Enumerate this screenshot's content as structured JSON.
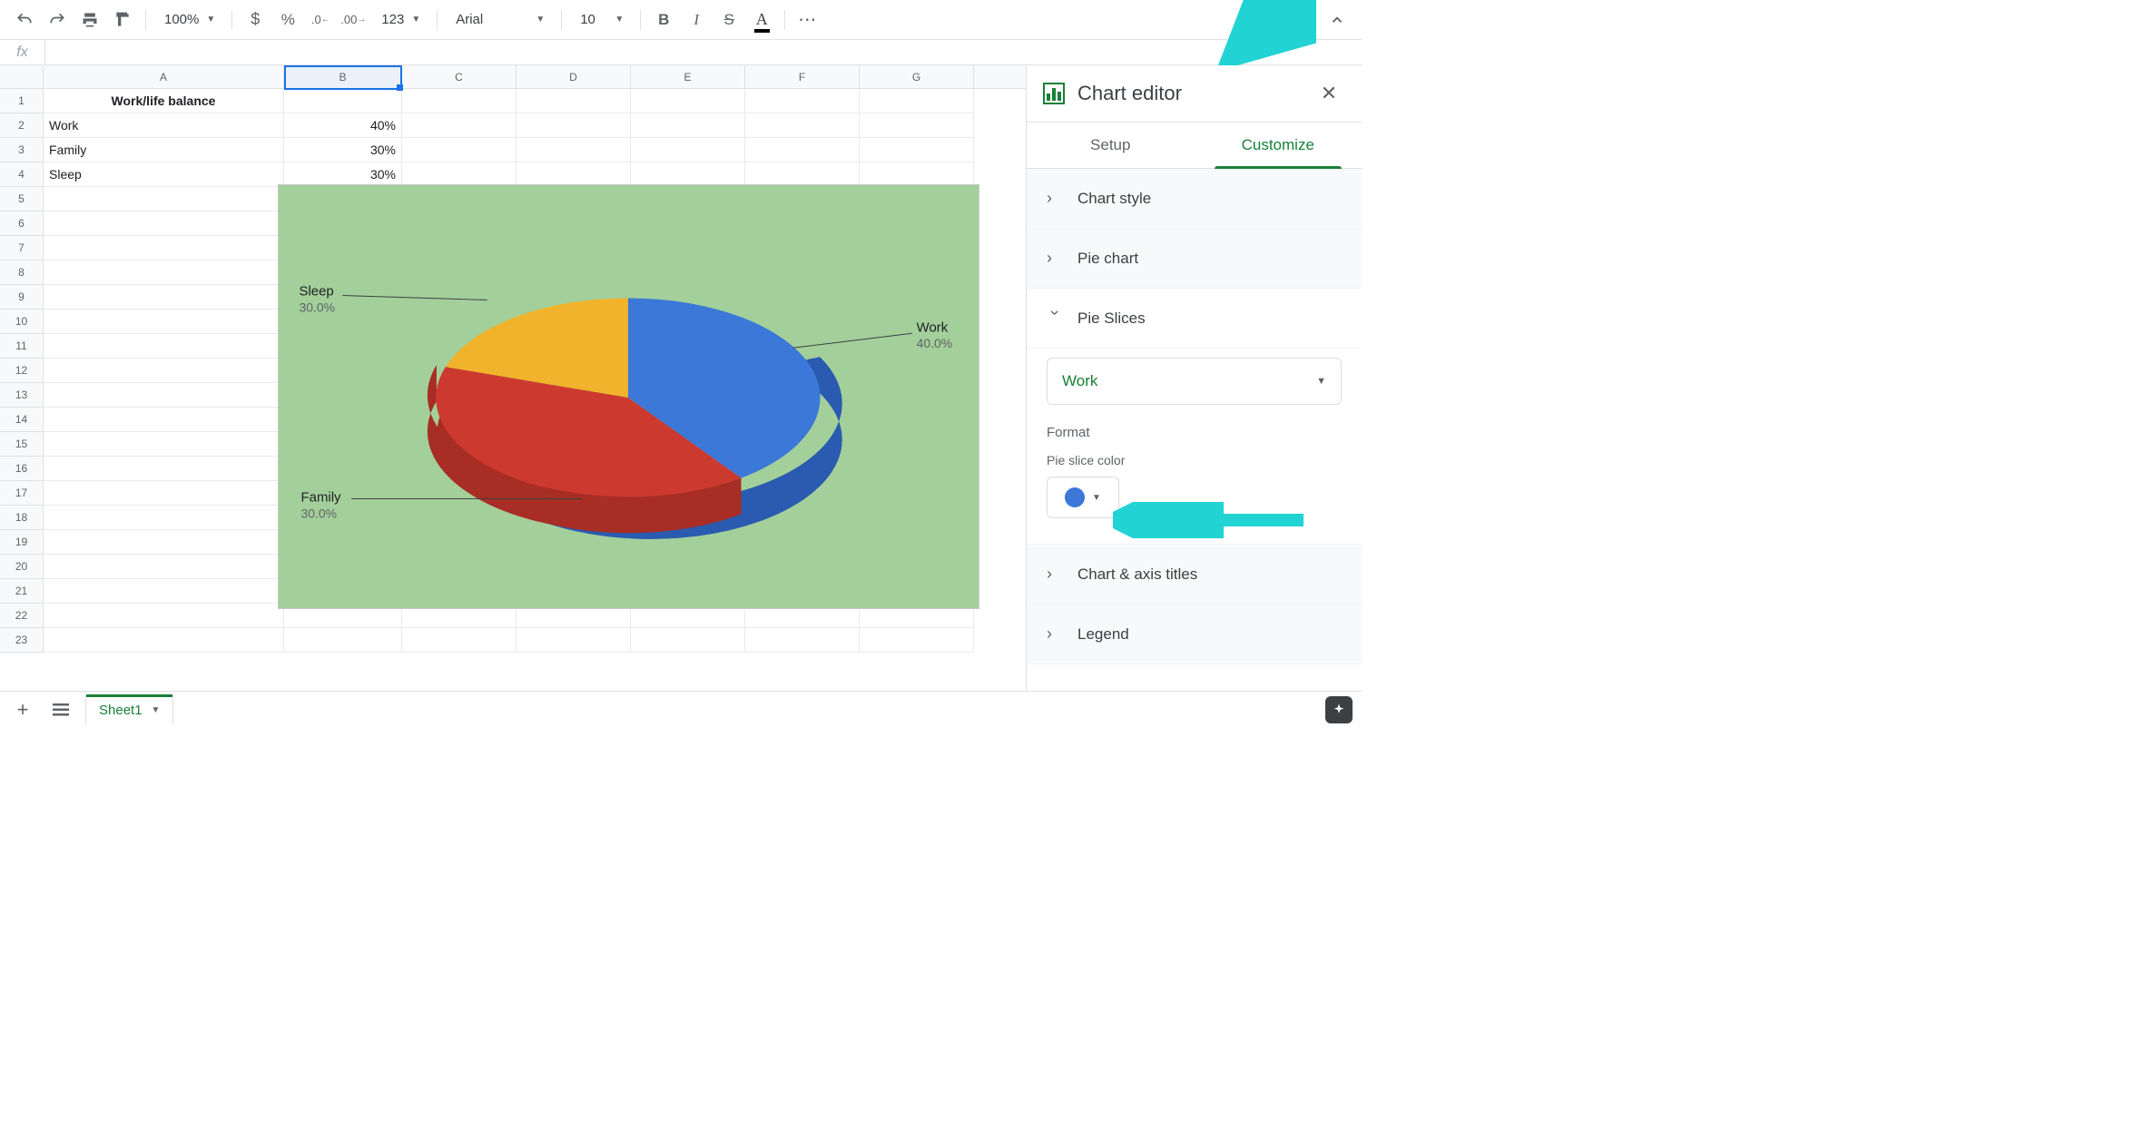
{
  "toolbar": {
    "zoom": "100%",
    "font": "Arial",
    "font_size": "10",
    "number_fmt": "123"
  },
  "formula_bar": {
    "fx": "fx",
    "value": ""
  },
  "columns": [
    "A",
    "B",
    "C",
    "D",
    "E",
    "F",
    "G"
  ],
  "grid": {
    "a1": "Work/life balance",
    "a2": "Work",
    "b2": "40%",
    "a3": "Family",
    "b3": "30%",
    "a4": "Sleep",
    "b4": "30%"
  },
  "chart_data": {
    "type": "pie",
    "title": "",
    "series": [
      {
        "name": "Work",
        "value": 40.0,
        "label": "40.0%",
        "color": "#3b78d8"
      },
      {
        "name": "Family",
        "value": 30.0,
        "label": "30.0%",
        "color": "#cc3a2f"
      },
      {
        "name": "Sleep",
        "value": 30.0,
        "label": "30.0%",
        "color": "#f1b32b"
      }
    ]
  },
  "chart_labels": {
    "work_name": "Work",
    "work_pct": "40.0%",
    "family_name": "Family",
    "family_pct": "30.0%",
    "sleep_name": "Sleep",
    "sleep_pct": "30.0%"
  },
  "sidebar": {
    "title": "Chart editor",
    "tabs": {
      "setup": "Setup",
      "customize": "Customize"
    },
    "sections": {
      "chart_style": "Chart style",
      "pie_chart": "Pie chart",
      "pie_slices": "Pie Slices",
      "chart_axis": "Chart & axis titles",
      "legend": "Legend"
    },
    "slice_select": "Work",
    "format_label": "Format",
    "slice_color_label": "Pie slice color",
    "slice_color": "#3b78d8"
  },
  "sheet_bar": {
    "name": "Sheet1"
  }
}
